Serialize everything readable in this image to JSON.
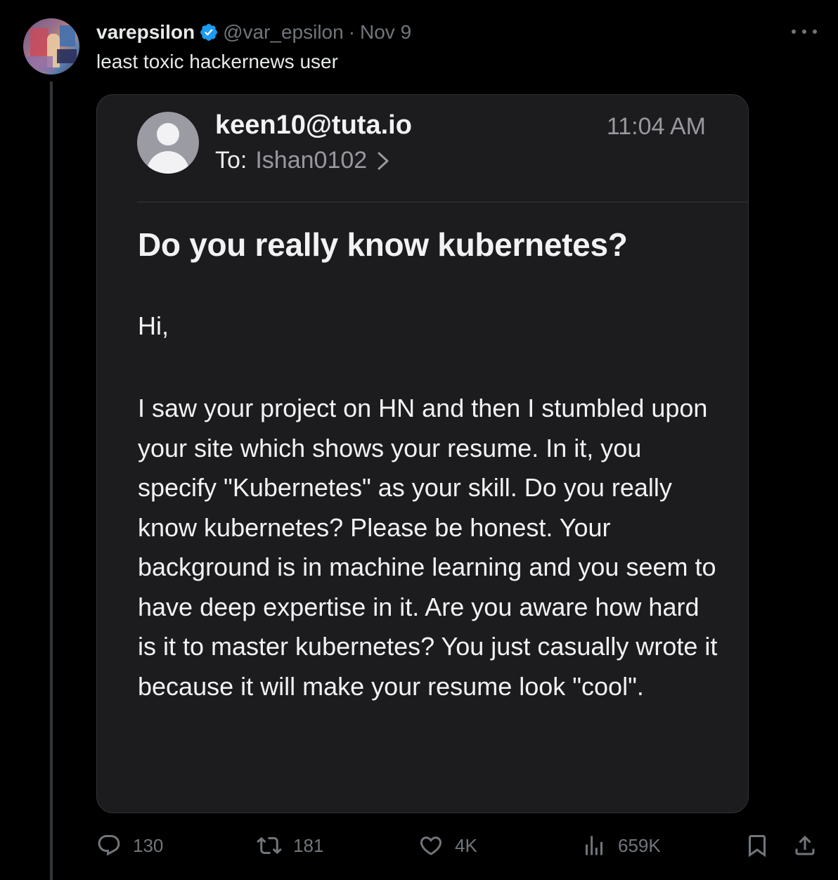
{
  "tweet": {
    "author_name": "varepsilon",
    "handle": "@var_epsilon",
    "separator": "·",
    "date": "Nov 9",
    "text": "least toxic hackernews user"
  },
  "email": {
    "from": "keen10@tuta.io",
    "to_label": "To:",
    "to": "Ishan0102",
    "time": "11:04 AM",
    "subject": "Do you really know kubernetes?",
    "greeting": "Hi,",
    "body": "I saw your project on HN and then I stumbled upon your site which shows your resume. In it, you specify \"Kubernetes\" as your skill. Do you really know kubernetes? Please be honest. Your background is in machine learning and you seem to have deep expertise in it. Are you aware how hard is it to master kubernetes? You just casually wrote it because it will make your resume look \"cool\"."
  },
  "actions": {
    "replies": "130",
    "reposts": "181",
    "likes": "4K",
    "views": "659K"
  },
  "colors": {
    "background": "#000000",
    "muted": "#71767b",
    "verified": "#1d9bf0",
    "card": "#1c1c1e"
  },
  "icons": {
    "verified": "verified-badge-icon",
    "more": "more-dots-icon",
    "reply": "reply-icon",
    "repost": "repost-icon",
    "like": "heart-icon",
    "views": "views-bar-icon",
    "bookmark": "bookmark-icon",
    "share": "share-icon"
  }
}
